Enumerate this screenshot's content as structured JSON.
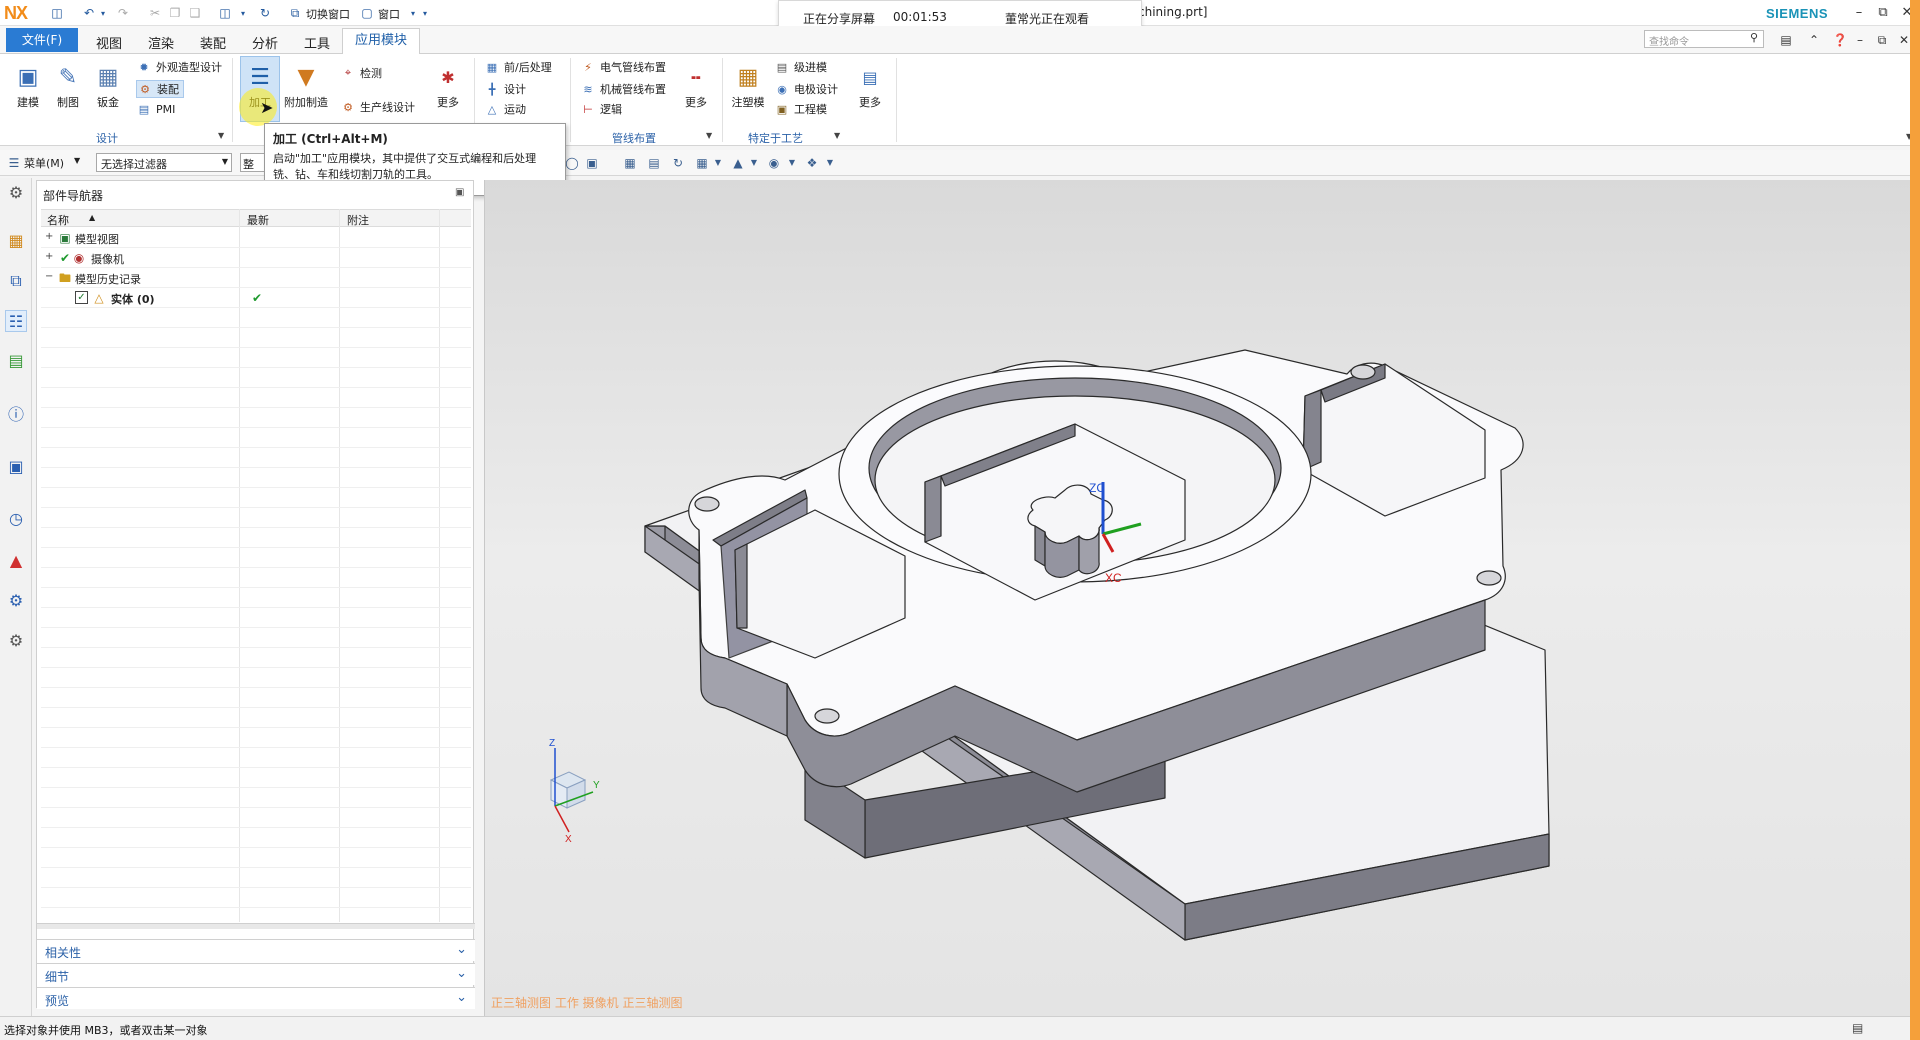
{
  "app": {
    "logo": "NX",
    "title_fragment": "chining.prt]",
    "brand": "SIEMENS"
  },
  "quick_access": {
    "switch_window": "切换窗口",
    "window": "窗口"
  },
  "share_banner": {
    "status": "正在分享屏幕",
    "time": "00:01:53",
    "viewer": "董常光正在观看"
  },
  "tabs": {
    "file": "文件(F)",
    "items": [
      "视图",
      "渲染",
      "装配",
      "分析",
      "工具"
    ],
    "active": "应用模块"
  },
  "search": {
    "placeholder": "查找命令"
  },
  "ribbon": {
    "design": {
      "label": "设计",
      "modeling": "建模",
      "drafting": "制图",
      "sheet_metal": "钣金",
      "shape_studio": "外观造型设计",
      "assembly": "装配",
      "pmi": "PMI"
    },
    "manufacturing": {
      "machining": "加工",
      "additive": "附加制造",
      "inspection": "检测",
      "line_designer": "生产线设计",
      "more": "更多"
    },
    "post": {
      "post_processing": "前/后处理",
      "design": "设计",
      "motion": "运动"
    },
    "routing": {
      "label": "管线布置",
      "electrical": "电气管线布置",
      "mechanical": "机械管线布置",
      "logical": "逻辑",
      "more": "更多"
    },
    "process": {
      "label": "特定于工艺",
      "mold": "注塑模",
      "progressive_die": "级进模",
      "electrode": "电极设计",
      "engineering_die": "工程模",
      "more": "更多"
    }
  },
  "tooltip": {
    "title": "加工 (Ctrl+Alt+M)",
    "body": "启动\"加工\"应用模块，其中提供了交互式编程和后处理铣、钻、车和线切割刀轨的工具。"
  },
  "toolbar": {
    "menu": "菜单(M)",
    "filter": "无选择过滤器",
    "scope": "整个"
  },
  "navigator": {
    "title": "部件导航器",
    "columns": [
      "名称",
      "最新",
      "附注"
    ],
    "tree": [
      {
        "label": "模型视图",
        "expand": "+"
      },
      {
        "label": "摄像机",
        "expand": "+"
      },
      {
        "label": "模型历史记录",
        "expand": "−"
      },
      {
        "label": "实体 (0)",
        "expand": ""
      }
    ],
    "panels": [
      "相关性",
      "细节",
      "预览"
    ]
  },
  "viewport": {
    "status": "正三轴测图 工作 摄像机 正三轴测图",
    "axis_labels": {
      "zc": "ZC",
      "xc": "XC"
    },
    "triad_labels": {
      "z": "Z",
      "y": "Y",
      "x": "X"
    }
  },
  "statusbar": {
    "text": "选择对象并使用 MB3，或者双击某一对象"
  },
  "colors": {
    "accent": "#2a7bd3",
    "nx_orange": "#f28c1a",
    "siemens": "#1a93b7",
    "viewport_status": "#f0a060"
  }
}
